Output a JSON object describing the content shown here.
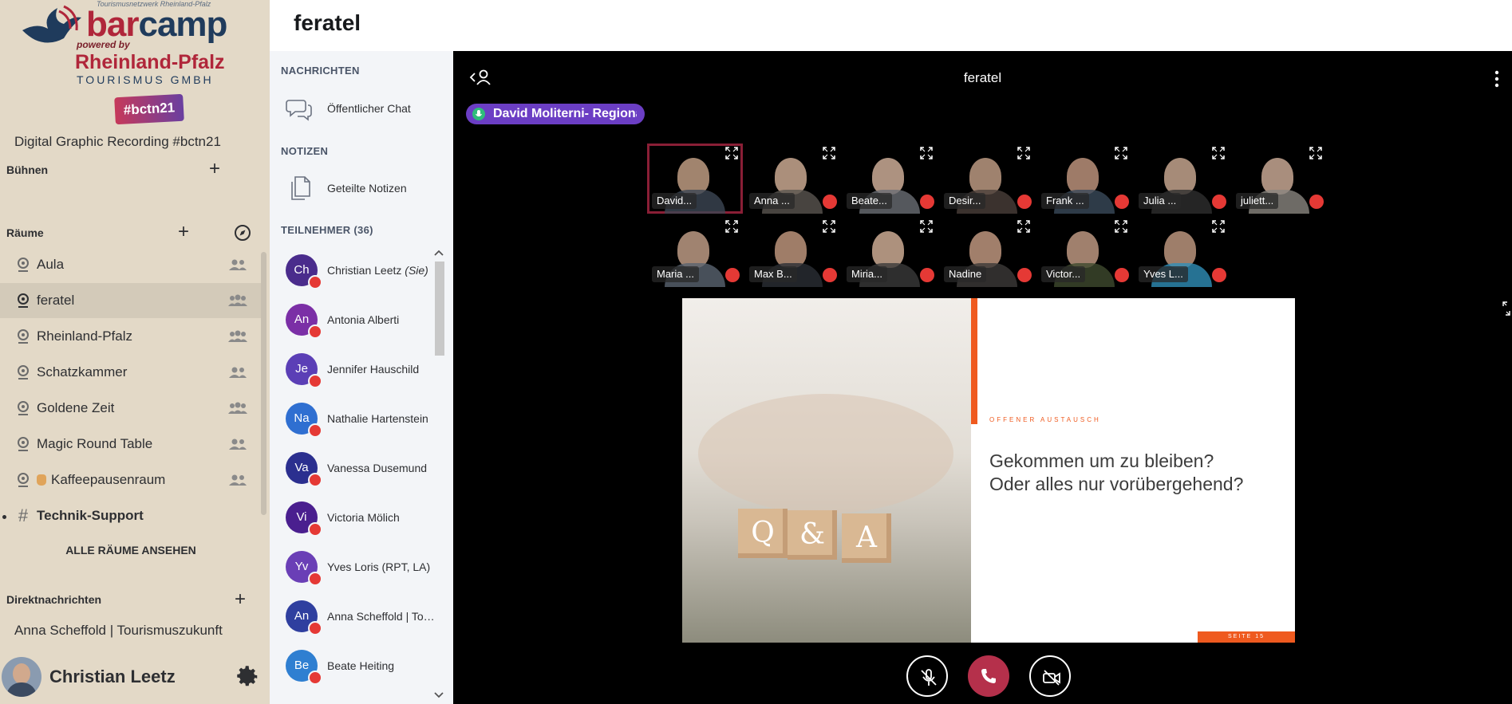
{
  "logo": {
    "tagline": "Tourismusnetzwerk Rheinland-Pfalz",
    "bar": "bar",
    "camp": "camp",
    "powered_by": "powered by",
    "org": "Rheinland-Pfalz",
    "org_sub": "TOURISMUS GMBH",
    "hashtag": "#bctn21"
  },
  "sidebar": {
    "space_name": "Digital Graphic Recording #bctn21",
    "stages_label": "Bühnen",
    "rooms_label": "Räume",
    "rooms": [
      {
        "label": "Aula"
      },
      {
        "label": "feratel"
      },
      {
        "label": "Rheinland-Pfalz"
      },
      {
        "label": "Schatzkammer"
      },
      {
        "label": "Goldene Zeit"
      },
      {
        "label": "Magic Round Table"
      },
      {
        "label": "Kaffeepausenraum"
      },
      {
        "label": "Technik-Support"
      }
    ],
    "all_rooms": "ALLE RÄUME ANSEHEN",
    "dm_label": "Direktnachrichten",
    "dms": [
      {
        "label": "Anna Scheffold | Tourismuszukunft"
      }
    ],
    "user_name": "Christian Leetz"
  },
  "header": {
    "title": "feratel"
  },
  "panel": {
    "messages_head": "NACHRICHTEN",
    "public_chat": "Öffentlicher Chat",
    "notes_head": "NOTIZEN",
    "shared_notes": "Geteilte Notizen",
    "participants_head": "TEILNEHMER (36)",
    "self_suffix": "(Sie)",
    "participants": [
      {
        "initials": "Ch",
        "name": "Christian Leetz",
        "color": "#4a2c8c"
      },
      {
        "initials": "An",
        "name": "Antonia Alberti",
        "color": "#7b2fa6"
      },
      {
        "initials": "Je",
        "name": "Jennifer Hauschild",
        "color": "#5b3fb6"
      },
      {
        "initials": "Na",
        "name": "Nathalie Hartenstein",
        "color": "#2f6fd1"
      },
      {
        "initials": "Va",
        "name": "Vanessa Dusemund",
        "color": "#2b2f8f"
      },
      {
        "initials": "Vi",
        "name": "Victoria Mölich",
        "color": "#4a1f8f"
      },
      {
        "initials": "Yv",
        "name": "Yves Loris (RPT, LA)",
        "color": "#6a3fb6"
      },
      {
        "initials": "An",
        "name": "Anna Scheffold | Tourismuszukunft",
        "color": "#2f3f9f"
      },
      {
        "initials": "Be",
        "name": "Beate Heiting",
        "color": "#2f7fd1"
      }
    ]
  },
  "video": {
    "title": "feratel",
    "speaker": "David Moliterni- Regionalmanagement",
    "tiles": [
      {
        "label": "David...",
        "bg": "#8a8f96",
        "skin": "#c9a58a"
      },
      {
        "label": "Anna ...",
        "bg": "#b9b4ad",
        "skin": "#d6b39a"
      },
      {
        "label": "Beate...",
        "bg": "#d9d4cf",
        "skin": "#d8b6a0"
      },
      {
        "label": "Desir...",
        "bg": "#9a9590",
        "skin": "#c7a38a"
      },
      {
        "label": "Frank ...",
        "bg": "#4f5a4a",
        "skin": "#c59a82"
      },
      {
        "label": "Julia ...",
        "bg": "#a9a39a",
        "skin": "#d0ae96"
      },
      {
        "label": "juliett...",
        "bg": "#6f6c68",
        "skin": "#d3b29c"
      },
      {
        "label": "Maria ...",
        "bg": "#9fa3a6",
        "skin": "#c8a48c"
      },
      {
        "label": "Max B...",
        "bg": "#7a1f24",
        "skin": "#c79c82"
      },
      {
        "label": "Miria...",
        "bg": "#cfcac3",
        "skin": "#d8b59c"
      },
      {
        "label": "Nadine",
        "bg": "#b3aea8",
        "skin": "#c99f86"
      },
      {
        "label": "Victor...",
        "bg": "#6f8f3f",
        "skin": "#c8a088"
      },
      {
        "label": "Yves L...",
        "bg": "#7f8890",
        "skin": "#c69d84"
      }
    ],
    "slide": {
      "kicker": "OFFENER AUSTAUSCH",
      "title_line1": "Gekommen um zu bleiben?",
      "title_line2": "Oder alles nur vorübergehend?",
      "cube_q": "Q",
      "cube_amp": "&",
      "cube_a": "A",
      "footer": "SEITE 15"
    }
  },
  "colors": {
    "accent": "#6b3ec4",
    "hangup": "#b5304b",
    "mute": "#e53935",
    "slide_accent": "#ef5a1f"
  }
}
